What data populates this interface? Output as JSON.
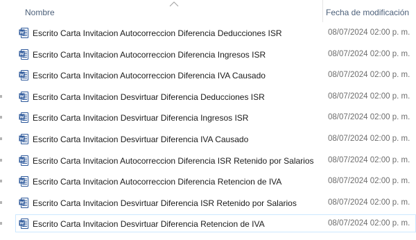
{
  "columns": {
    "name": "Nombre",
    "date": "Fecha de modificación"
  },
  "files": [
    {
      "name": "Escrito Carta Invitacion  Autocorreccion Diferencia Deducciones ISR",
      "date": "08/07/2024 02:00 p. m."
    },
    {
      "name": "Escrito Carta Invitacion  Autocorreccion Diferencia Ingresos ISR",
      "date": "08/07/2024 02:00 p. m."
    },
    {
      "name": "Escrito Carta Invitacion  Autocorreccion Diferencia IVA Causado",
      "date": "08/07/2024 02:00 p. m."
    },
    {
      "name": "Escrito Carta Invitacion  Desvirtuar Diferencia Deducciones ISR",
      "date": "08/07/2024 02:00 p. m."
    },
    {
      "name": "Escrito Carta Invitacion  Desvirtuar Diferencia Ingresos ISR",
      "date": "08/07/2024 02:00 p. m."
    },
    {
      "name": "Escrito Carta Invitacion  Desvirtuar Diferencia IVA Causado",
      "date": "08/07/2024 02:00 p. m."
    },
    {
      "name": "Escrito Carta Invitacion Autocorreccion Diferencia ISR Retenido por Salarios",
      "date": "08/07/2024 02:00 p. m."
    },
    {
      "name": "Escrito Carta Invitacion Autocorreccion Diferencia Retencion de IVA",
      "date": "08/07/2024 02:00 p. m."
    },
    {
      "name": "Escrito Carta Invitacion Desvirtuar Diferencia ISR Retenido por Salarios",
      "date": "08/07/2024 02:00 p. m."
    },
    {
      "name": "Escrito Carta Invitacion Desvirtuar Diferencia Retencion de IVA",
      "date": "08/07/2024 02:00 p. m."
    }
  ],
  "icons": {
    "file": "word-document-icon",
    "sort": "sort-ascending-icon"
  },
  "colors": {
    "header_text": "#4c607a",
    "file_text": "#1a1a1a",
    "date_text": "#6d6d6d",
    "selection_border": "#cce8ff",
    "icon_blue": "#2b579a"
  }
}
